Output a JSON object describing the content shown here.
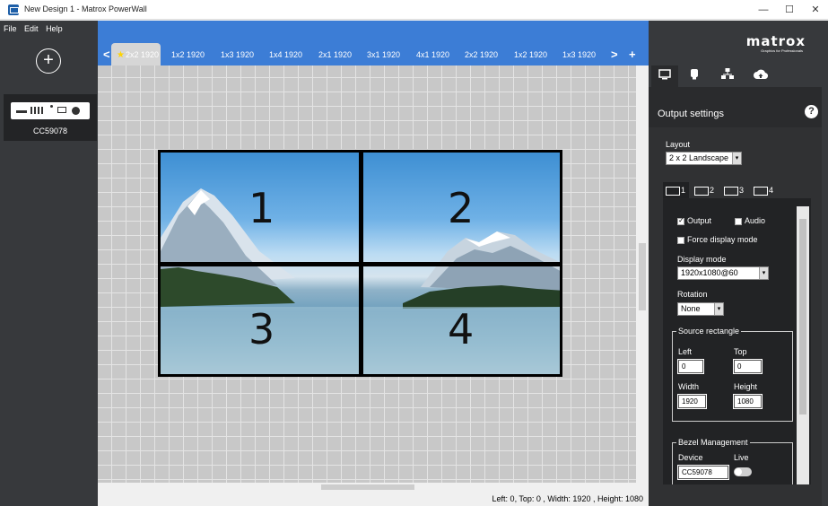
{
  "window": {
    "title": "New Design 1 - Matrox PowerWall",
    "minimize": "—",
    "maximize": "☐",
    "close": "✕"
  },
  "menu": [
    "File",
    "Edit",
    "Help"
  ],
  "sidebar": {
    "add_label": "+",
    "device_name": "CC59078"
  },
  "tabs": {
    "prev": "<",
    "next": ">",
    "add": "+",
    "items": [
      {
        "label": "2x2 1920",
        "favorite": true,
        "active": true
      },
      {
        "label": "1x2 1920"
      },
      {
        "label": "1x3 1920"
      },
      {
        "label": "1x4 1920"
      },
      {
        "label": "2x1 1920"
      },
      {
        "label": "3x1 1920"
      },
      {
        "label": "4x1 1920"
      },
      {
        "label": "2x2 1920"
      },
      {
        "label": "1x2 1920"
      },
      {
        "label": "1x3 1920"
      }
    ]
  },
  "wall": {
    "screens": [
      "1",
      "2",
      "3",
      "4"
    ]
  },
  "status": {
    "text": "Left: 0, Top: 0 , Width: 1920 , Height: 1080"
  },
  "panel": {
    "logo": "matrox",
    "logo_sub": "Graphics for Professionals",
    "tabs": [
      "monitor-icon",
      "device-icon",
      "network-icon",
      "upload-icon"
    ],
    "title": "Output settings",
    "help": "?",
    "layout_label": "Layout",
    "layout_value": "2 x 2 Landscape",
    "output_tabs": [
      "1",
      "2",
      "3",
      "4"
    ],
    "output_label": "Output",
    "output_checked": true,
    "audio_label": "Audio",
    "audio_checked": false,
    "force_label": "Force display mode",
    "force_checked": false,
    "display_mode_label": "Display mode",
    "display_mode_value": "1920x1080@60",
    "rotation_label": "Rotation",
    "rotation_value": "None",
    "source_rect_label": "Source rectangle",
    "left_label": "Left",
    "left_value": "0",
    "top_label": "Top",
    "top_value": "0",
    "width_label": "Width",
    "width_value": "1920",
    "height_label": "Height",
    "height_value": "1080",
    "bezel_label": "Bezel Management",
    "device_label": "Device",
    "live_label": "Live",
    "device_value": "CC59078"
  },
  "colors": {
    "tabbar": "#3c7dd6",
    "sidebar": "#37393c",
    "canvas": "#c8c8c8"
  }
}
